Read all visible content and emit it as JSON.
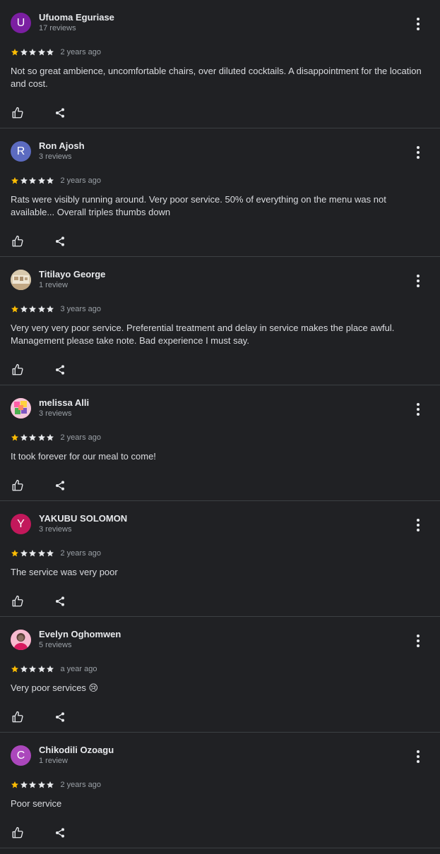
{
  "colors": {
    "background": "#202124",
    "star_filled": "#fbbc04",
    "star_empty": "#e8eaed",
    "text_primary": "#e8eaed",
    "text_secondary": "#9aa0a6",
    "divider": "#3c4043"
  },
  "icons": {
    "like": "thumbs-up-icon",
    "share": "share-icon",
    "menu": "more-vert-icon",
    "star": "star-icon"
  },
  "reviews": [
    {
      "initial": "U",
      "avatar_color": "#7b1fa2",
      "avatar_kind": "letter",
      "name": "Ufuoma Eguriase",
      "count": "17 reviews",
      "rating": 1,
      "max_rating": 5,
      "when": "2 years ago",
      "text": "Not so great ambience, uncomfortable chairs, over diluted cocktails. A disappointment for the location and cost."
    },
    {
      "initial": "R",
      "avatar_color": "#5c6bc0",
      "avatar_kind": "letter",
      "name": "Ron Ajosh",
      "count": "3 reviews",
      "rating": 1,
      "max_rating": 5,
      "when": "2 years ago",
      "text": "Rats were visibly running around. Very poor service. 50% of everything on the menu was not available... Overall triples thumbs down"
    },
    {
      "initial": "",
      "avatar_color": "#c9b79c",
      "avatar_kind": "photo-room",
      "name": "Titilayo George",
      "count": "1 review",
      "rating": 1,
      "max_rating": 5,
      "when": "3 years ago",
      "text": "Very very very poor service. Preferential treatment and delay in service makes the place awful. Management please take note. Bad experience I must say."
    },
    {
      "initial": "",
      "avatar_color": "#e91e63",
      "avatar_kind": "photo-colorful",
      "name": "melissa Alli",
      "count": "3 reviews",
      "rating": 1,
      "max_rating": 5,
      "when": "2 years ago",
      "text": "It took forever for our meal to come!"
    },
    {
      "initial": "Y",
      "avatar_color": "#c2185b",
      "avatar_kind": "letter",
      "name": "YAKUBU SOLOMON",
      "count": "3 reviews",
      "rating": 1,
      "max_rating": 5,
      "when": "2 years ago",
      "text": "The service was very poor"
    },
    {
      "initial": "",
      "avatar_color": "#d81b60",
      "avatar_kind": "photo-person",
      "name": "Evelyn Oghomwen",
      "count": "5 reviews",
      "rating": 1,
      "max_rating": 5,
      "when": "a year ago",
      "text": "Very poor services 😢"
    },
    {
      "initial": "C",
      "avatar_color": "#ab47bc",
      "avatar_kind": "letter",
      "name": "Chikodili Ozoagu",
      "count": "1 review",
      "rating": 1,
      "max_rating": 5,
      "when": "2 years ago",
      "text": "Poor service"
    }
  ]
}
